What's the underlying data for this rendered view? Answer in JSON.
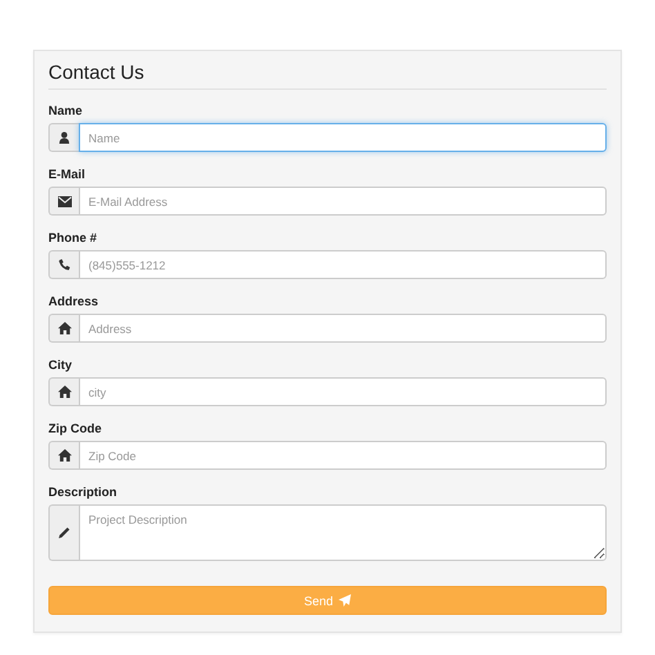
{
  "form": {
    "title": "Contact Us",
    "fields": [
      {
        "kind": "person",
        "label": "Name",
        "placeholder": "Name",
        "focused": true
      },
      {
        "kind": "mail",
        "label": "E-Mail",
        "placeholder": "E-Mail Address",
        "focused": false
      },
      {
        "kind": "phone",
        "label": "Phone #",
        "placeholder": "(845)555-1212",
        "focused": false
      },
      {
        "kind": "home",
        "label": "Address",
        "placeholder": "Address",
        "focused": false
      },
      {
        "kind": "home",
        "label": "City",
        "placeholder": "city",
        "focused": false
      },
      {
        "kind": "home",
        "label": "Zip Code",
        "placeholder": "Zip Code",
        "focused": false
      },
      {
        "kind": "note",
        "label": "Description",
        "placeholder": "Project Description",
        "focused": false
      }
    ],
    "submit": {
      "label": "Send"
    }
  }
}
